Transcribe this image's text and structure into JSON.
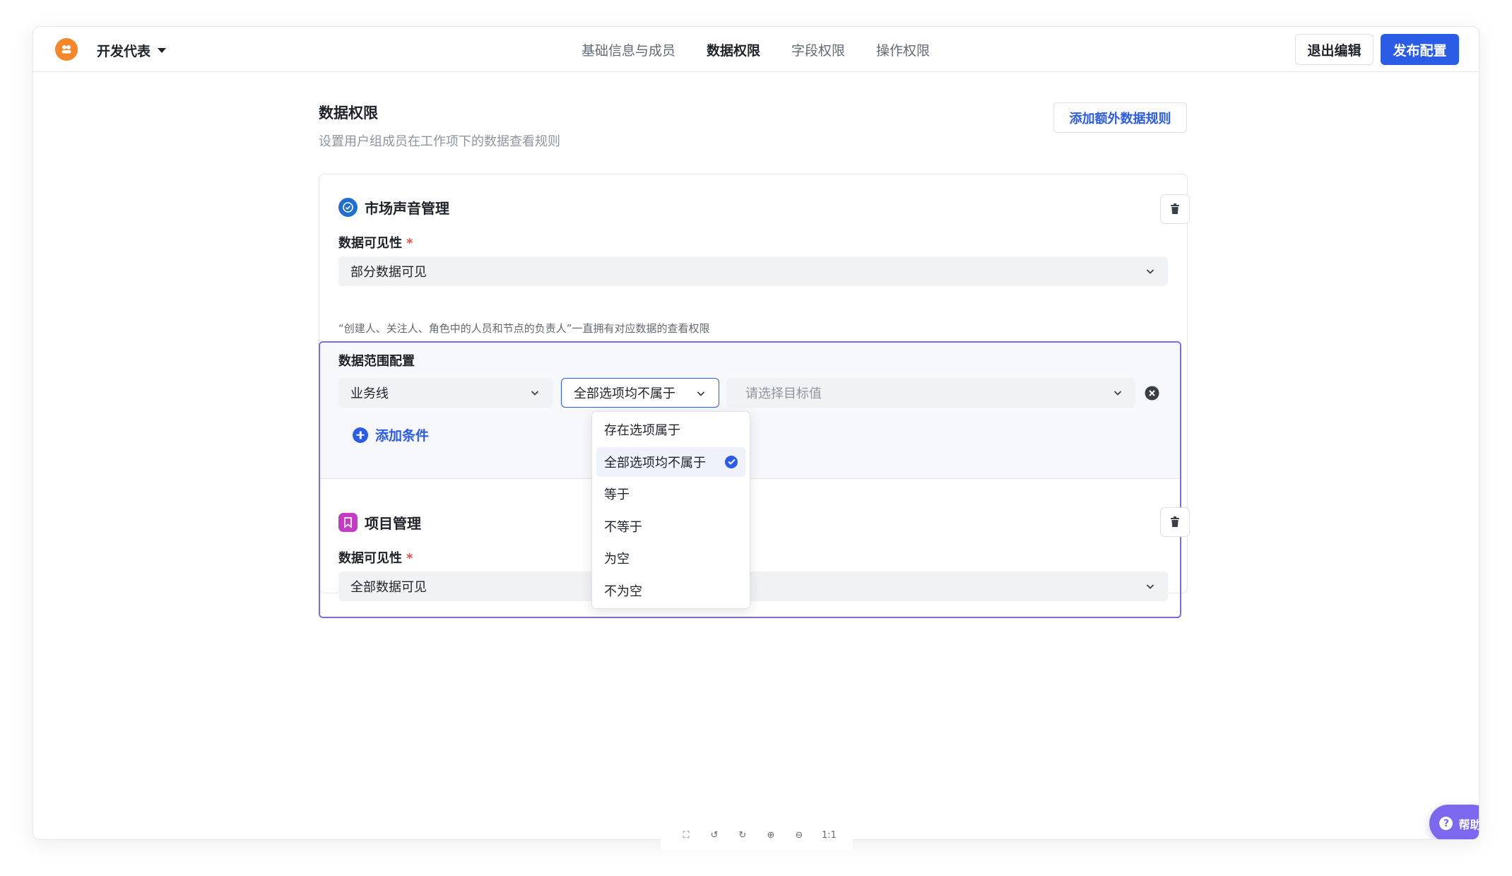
{
  "header": {
    "project_name": "开发代表",
    "tabs": [
      "基础信息与成员",
      "数据权限",
      "字段权限",
      "操作权限"
    ],
    "active_tab": "数据权限",
    "exit_label": "退出编辑",
    "publish_label": "发布配置"
  },
  "section": {
    "title": "数据权限",
    "description": "设置用户组成员在工作项下的数据查看规则",
    "add_rule_label": "添加额外数据规则"
  },
  "rules": [
    {
      "name": "市场声音管理",
      "visibility_label": "数据可见性",
      "visibility_value": "部分数据可见",
      "hint": "“创建人、关注人、角色中的人员和节点的负责人”一直拥有对应数据的查看权限",
      "range": {
        "label": "数据范围配置",
        "field": "业务线",
        "operator": "全部选项均不属于",
        "target_placeholder": "请选择目标值",
        "add_condition_label": "添加条件"
      }
    },
    {
      "name": "项目管理",
      "visibility_label": "数据可见性",
      "visibility_value": "全部数据可见"
    }
  ],
  "operator_dropdown": {
    "options": [
      "存在选项属于",
      "全部选项均不属于",
      "等于",
      "不等于",
      "为空",
      "不为空"
    ],
    "selected": "全部选项均不属于"
  },
  "help_label": "帮助",
  "zoom_controls": [
    "fit-icon",
    "rotate-left-icon",
    "rotate-right-icon",
    "zoom-in-icon",
    "zoom-out-icon"
  ],
  "zoom_reset_label": "1:1",
  "colors": {
    "primary": "#2b5ce6",
    "highlight_border": "#7a6af0",
    "help": "#7b68ee",
    "logo": "#f5862a"
  }
}
